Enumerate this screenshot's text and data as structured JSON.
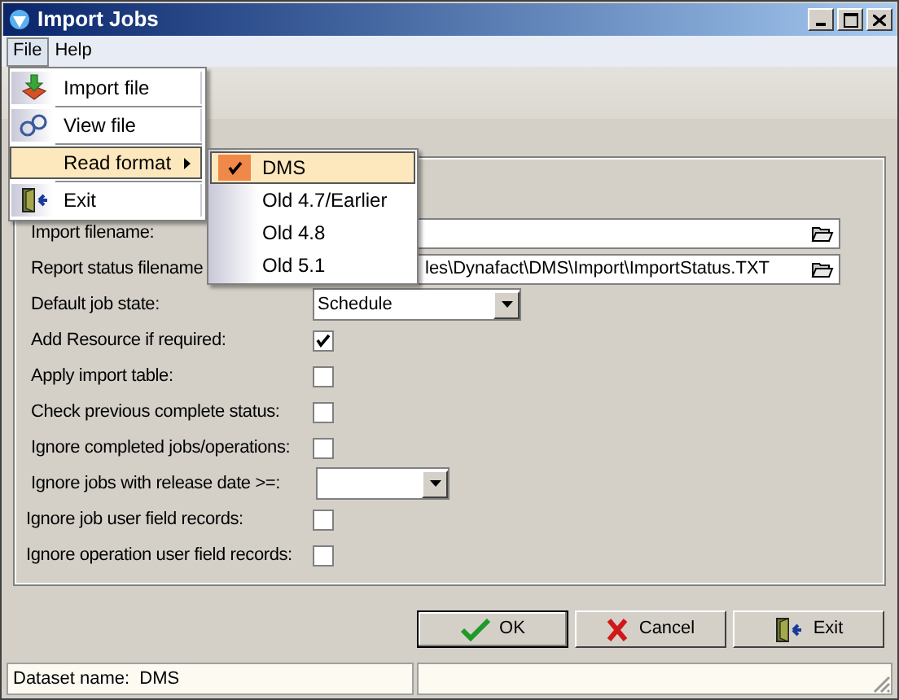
{
  "window": {
    "title": "Import Jobs"
  },
  "menu_bar": [
    {
      "label": "File",
      "selected": true
    },
    {
      "label": "Help",
      "selected": false
    }
  ],
  "file_menu": [
    {
      "label": "Import file",
      "selected": false,
      "submenu": false
    },
    {
      "label": "View file",
      "selected": false,
      "submenu": false
    },
    {
      "label": "Read format",
      "selected": true,
      "submenu": true
    },
    {
      "label": "Exit",
      "selected": false,
      "submenu": false
    }
  ],
  "read_format_menu": [
    {
      "label": "DMS",
      "checked": true,
      "selected": true
    },
    {
      "label": "Old 4.7/Earlier",
      "checked": false,
      "selected": false
    },
    {
      "label": "Old 4.8",
      "checked": false,
      "selected": false
    },
    {
      "label": "Old 5.1",
      "checked": false,
      "selected": false
    }
  ],
  "form": [
    {
      "label": "Import filename:",
      "kind": "file"
    },
    {
      "label": "Report status filename",
      "kind": "file",
      "value": "les\\Dynafact\\DMS\\Import\\ImportStatus.TXT"
    },
    {
      "label": "Default job state:",
      "kind": "select",
      "value": "Schedule"
    },
    {
      "label": "Add Resource if required:",
      "kind": "checkbox",
      "checked": true
    },
    {
      "label": "Apply import table:",
      "kind": "checkbox",
      "checked": false
    },
    {
      "label": "Check previous complete status:",
      "kind": "checkbox",
      "checked": false
    },
    {
      "label": "Ignore completed jobs/operations:",
      "kind": "checkbox",
      "checked": false
    },
    {
      "label": "Ignore jobs with release date >=:",
      "kind": "date"
    },
    {
      "label": "Ignore job user field records:",
      "kind": "checkbox",
      "checked": false
    },
    {
      "label": "Ignore operation user field records:",
      "kind": "checkbox",
      "checked": false
    }
  ],
  "buttons": [
    {
      "label": "OK",
      "default": true
    },
    {
      "label": "Cancel",
      "default": false
    },
    {
      "label": "Exit",
      "default": false
    }
  ],
  "status_bar": [
    "Dataset name:  DMS"
  ]
}
